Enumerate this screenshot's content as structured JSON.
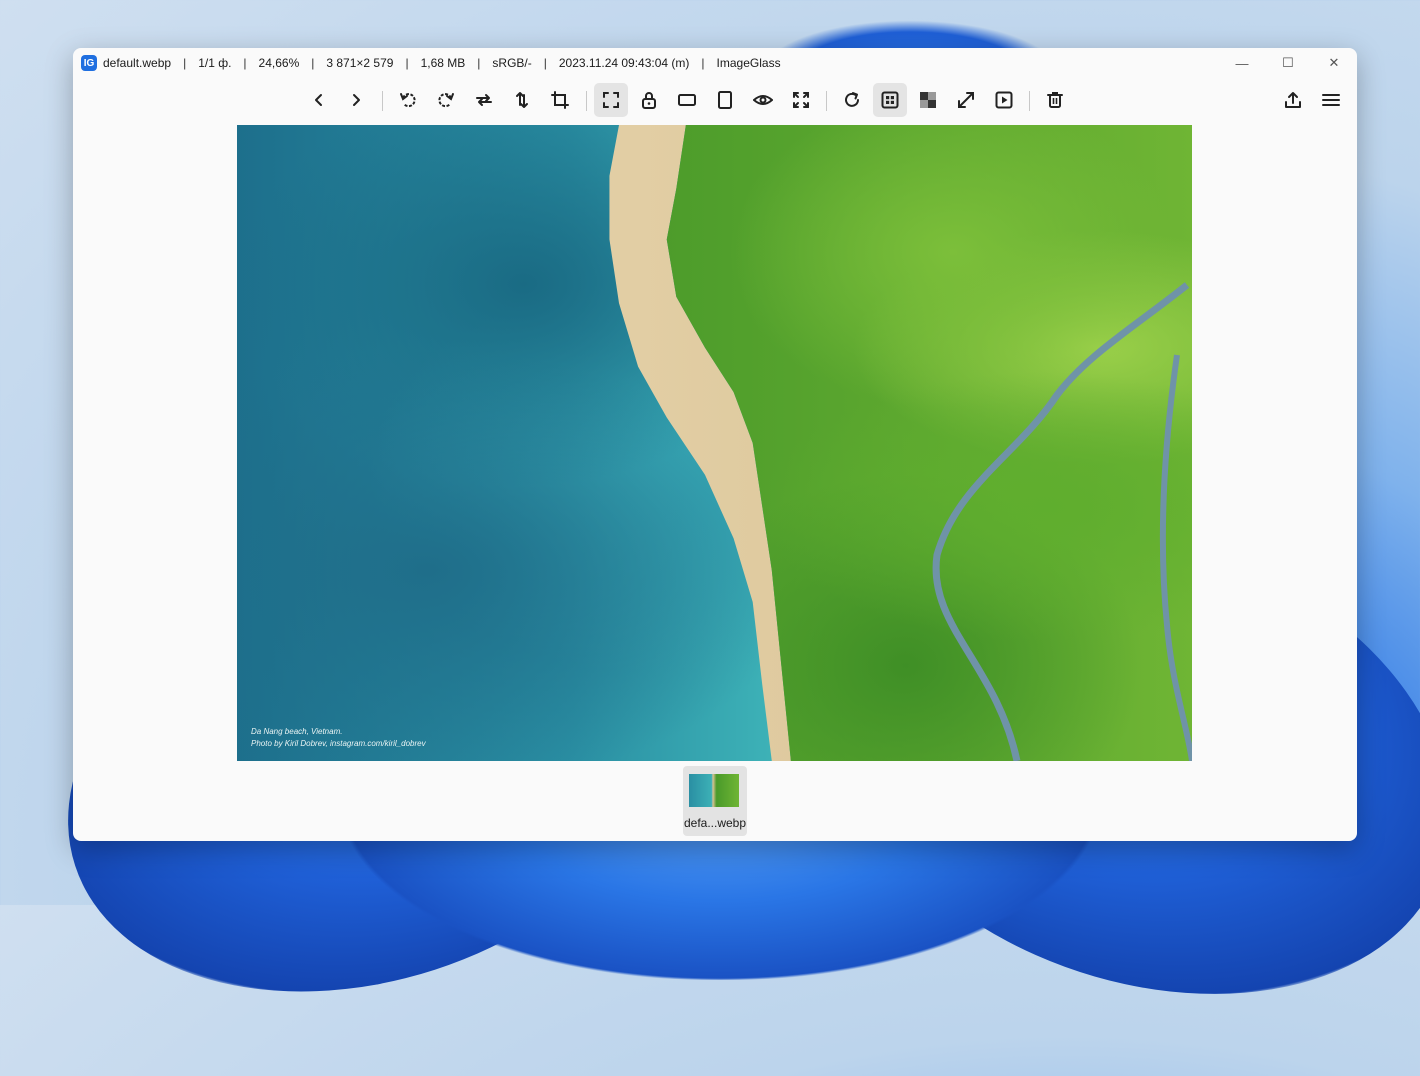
{
  "titlebar": {
    "app_icon": "imageglass-icon",
    "filename": "default.webp",
    "index": "1/1 ф.",
    "zoom": "24,66%",
    "dimensions": "3 871×2 579",
    "filesize": "1,68 MB",
    "color_profile": "sRGB/-",
    "datetime": "2023.11.24 09:43:04 (m)",
    "app_name": "ImageGlass",
    "separator": "|",
    "controls": {
      "minimize": "—",
      "maximize": "☐",
      "close": "✕"
    }
  },
  "toolbar": {
    "buttons": [
      {
        "icon": "chevron-left-icon"
      },
      {
        "icon": "chevron-right-icon"
      },
      {
        "icon": "rotate-left-icon"
      },
      {
        "icon": "rotate-right-icon"
      },
      {
        "icon": "flip-horizontal-icon"
      },
      {
        "icon": "flip-vertical-icon"
      },
      {
        "icon": "crop-icon"
      },
      {
        "icon": "auto-zoom-icon",
        "active": true
      },
      {
        "icon": "lock-zoom-icon"
      },
      {
        "icon": "scale-to-width-icon"
      },
      {
        "icon": "scale-to-height-icon"
      },
      {
        "icon": "eye-icon"
      },
      {
        "icon": "scale-to-fit-icon"
      },
      {
        "icon": "refresh-icon"
      },
      {
        "icon": "gallery-icon",
        "active": true
      },
      {
        "icon": "checkerboard-icon"
      },
      {
        "icon": "fullscreen-icon"
      },
      {
        "icon": "slideshow-icon"
      },
      {
        "icon": "delete-icon"
      },
      {
        "icon": "share-icon"
      },
      {
        "icon": "menu-icon"
      }
    ]
  },
  "image": {
    "caption_line1": "Da Nang beach, Vietnam.",
    "caption_line2": "Photo by Kiril Dobrev, instagram.com/kiril_dobrev"
  },
  "thumbnails": [
    {
      "label": "defa...webp",
      "selected": true
    }
  ],
  "colors": {
    "accent": "#1f6fe0",
    "window_bg": "#fafafa",
    "active_btn": "#e4e4e4"
  }
}
